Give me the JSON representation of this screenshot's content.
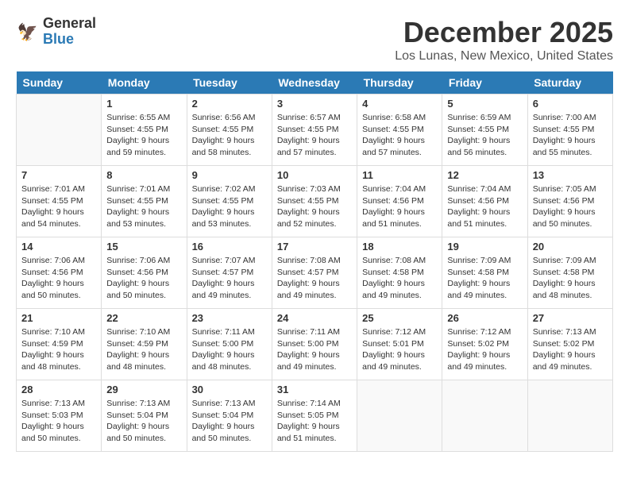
{
  "header": {
    "logo_line1": "General",
    "logo_line2": "Blue",
    "month": "December 2025",
    "location": "Los Lunas, New Mexico, United States"
  },
  "days_of_week": [
    "Sunday",
    "Monday",
    "Tuesday",
    "Wednesday",
    "Thursday",
    "Friday",
    "Saturday"
  ],
  "weeks": [
    [
      {
        "day": "",
        "info": ""
      },
      {
        "day": "1",
        "info": "Sunrise: 6:55 AM\nSunset: 4:55 PM\nDaylight: 9 hours\nand 59 minutes."
      },
      {
        "day": "2",
        "info": "Sunrise: 6:56 AM\nSunset: 4:55 PM\nDaylight: 9 hours\nand 58 minutes."
      },
      {
        "day": "3",
        "info": "Sunrise: 6:57 AM\nSunset: 4:55 PM\nDaylight: 9 hours\nand 57 minutes."
      },
      {
        "day": "4",
        "info": "Sunrise: 6:58 AM\nSunset: 4:55 PM\nDaylight: 9 hours\nand 57 minutes."
      },
      {
        "day": "5",
        "info": "Sunrise: 6:59 AM\nSunset: 4:55 PM\nDaylight: 9 hours\nand 56 minutes."
      },
      {
        "day": "6",
        "info": "Sunrise: 7:00 AM\nSunset: 4:55 PM\nDaylight: 9 hours\nand 55 minutes."
      }
    ],
    [
      {
        "day": "7",
        "info": "Sunrise: 7:01 AM\nSunset: 4:55 PM\nDaylight: 9 hours\nand 54 minutes."
      },
      {
        "day": "8",
        "info": "Sunrise: 7:01 AM\nSunset: 4:55 PM\nDaylight: 9 hours\nand 53 minutes."
      },
      {
        "day": "9",
        "info": "Sunrise: 7:02 AM\nSunset: 4:55 PM\nDaylight: 9 hours\nand 53 minutes."
      },
      {
        "day": "10",
        "info": "Sunrise: 7:03 AM\nSunset: 4:55 PM\nDaylight: 9 hours\nand 52 minutes."
      },
      {
        "day": "11",
        "info": "Sunrise: 7:04 AM\nSunset: 4:56 PM\nDaylight: 9 hours\nand 51 minutes."
      },
      {
        "day": "12",
        "info": "Sunrise: 7:04 AM\nSunset: 4:56 PM\nDaylight: 9 hours\nand 51 minutes."
      },
      {
        "day": "13",
        "info": "Sunrise: 7:05 AM\nSunset: 4:56 PM\nDaylight: 9 hours\nand 50 minutes."
      }
    ],
    [
      {
        "day": "14",
        "info": "Sunrise: 7:06 AM\nSunset: 4:56 PM\nDaylight: 9 hours\nand 50 minutes."
      },
      {
        "day": "15",
        "info": "Sunrise: 7:06 AM\nSunset: 4:56 PM\nDaylight: 9 hours\nand 50 minutes."
      },
      {
        "day": "16",
        "info": "Sunrise: 7:07 AM\nSunset: 4:57 PM\nDaylight: 9 hours\nand 49 minutes."
      },
      {
        "day": "17",
        "info": "Sunrise: 7:08 AM\nSunset: 4:57 PM\nDaylight: 9 hours\nand 49 minutes."
      },
      {
        "day": "18",
        "info": "Sunrise: 7:08 AM\nSunset: 4:58 PM\nDaylight: 9 hours\nand 49 minutes."
      },
      {
        "day": "19",
        "info": "Sunrise: 7:09 AM\nSunset: 4:58 PM\nDaylight: 9 hours\nand 49 minutes."
      },
      {
        "day": "20",
        "info": "Sunrise: 7:09 AM\nSunset: 4:58 PM\nDaylight: 9 hours\nand 48 minutes."
      }
    ],
    [
      {
        "day": "21",
        "info": "Sunrise: 7:10 AM\nSunset: 4:59 PM\nDaylight: 9 hours\nand 48 minutes."
      },
      {
        "day": "22",
        "info": "Sunrise: 7:10 AM\nSunset: 4:59 PM\nDaylight: 9 hours\nand 48 minutes."
      },
      {
        "day": "23",
        "info": "Sunrise: 7:11 AM\nSunset: 5:00 PM\nDaylight: 9 hours\nand 48 minutes."
      },
      {
        "day": "24",
        "info": "Sunrise: 7:11 AM\nSunset: 5:00 PM\nDaylight: 9 hours\nand 49 minutes."
      },
      {
        "day": "25",
        "info": "Sunrise: 7:12 AM\nSunset: 5:01 PM\nDaylight: 9 hours\nand 49 minutes."
      },
      {
        "day": "26",
        "info": "Sunrise: 7:12 AM\nSunset: 5:02 PM\nDaylight: 9 hours\nand 49 minutes."
      },
      {
        "day": "27",
        "info": "Sunrise: 7:13 AM\nSunset: 5:02 PM\nDaylight: 9 hours\nand 49 minutes."
      }
    ],
    [
      {
        "day": "28",
        "info": "Sunrise: 7:13 AM\nSunset: 5:03 PM\nDaylight: 9 hours\nand 50 minutes."
      },
      {
        "day": "29",
        "info": "Sunrise: 7:13 AM\nSunset: 5:04 PM\nDaylight: 9 hours\nand 50 minutes."
      },
      {
        "day": "30",
        "info": "Sunrise: 7:13 AM\nSunset: 5:04 PM\nDaylight: 9 hours\nand 50 minutes."
      },
      {
        "day": "31",
        "info": "Sunrise: 7:14 AM\nSunset: 5:05 PM\nDaylight: 9 hours\nand 51 minutes."
      },
      {
        "day": "",
        "info": ""
      },
      {
        "day": "",
        "info": ""
      },
      {
        "day": "",
        "info": ""
      }
    ]
  ]
}
